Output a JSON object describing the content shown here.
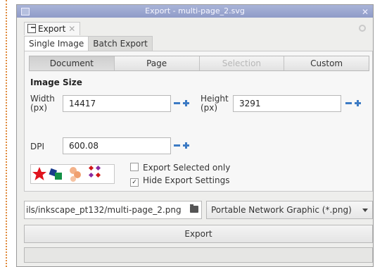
{
  "window": {
    "title": "Export - multi-page_2.svg"
  },
  "dock_tab": {
    "label": "Export"
  },
  "subtabs": [
    "Single Image",
    "Batch Export"
  ],
  "modes": [
    {
      "label": "Document",
      "state": "active"
    },
    {
      "label": "Page",
      "state": "normal"
    },
    {
      "label": "Selection",
      "state": "disabled"
    },
    {
      "label": "Custom",
      "state": "normal"
    }
  ],
  "image_size": {
    "title": "Image Size",
    "width_label": "Width\n(px)",
    "width_value": "14417",
    "height_label": "Height\n(px)",
    "height_value": "3291",
    "dpi_label": "DPI",
    "dpi_value": "600.08"
  },
  "options": {
    "export_selected_only": {
      "label": "Export Selected only",
      "checked": false
    },
    "hide_export_settings": {
      "label": "Hide Export Settings",
      "checked": true
    }
  },
  "file": {
    "path": "ils/inkscape_pt132/multi-page_2.png",
    "format": "Portable Network Graphic (*.png)"
  },
  "export_button": {
    "label": "Export"
  },
  "progress": {
    "fraction": 0
  },
  "colors": {
    "accent": "#3d7bc4",
    "titlebar": "#9aa5cf"
  }
}
